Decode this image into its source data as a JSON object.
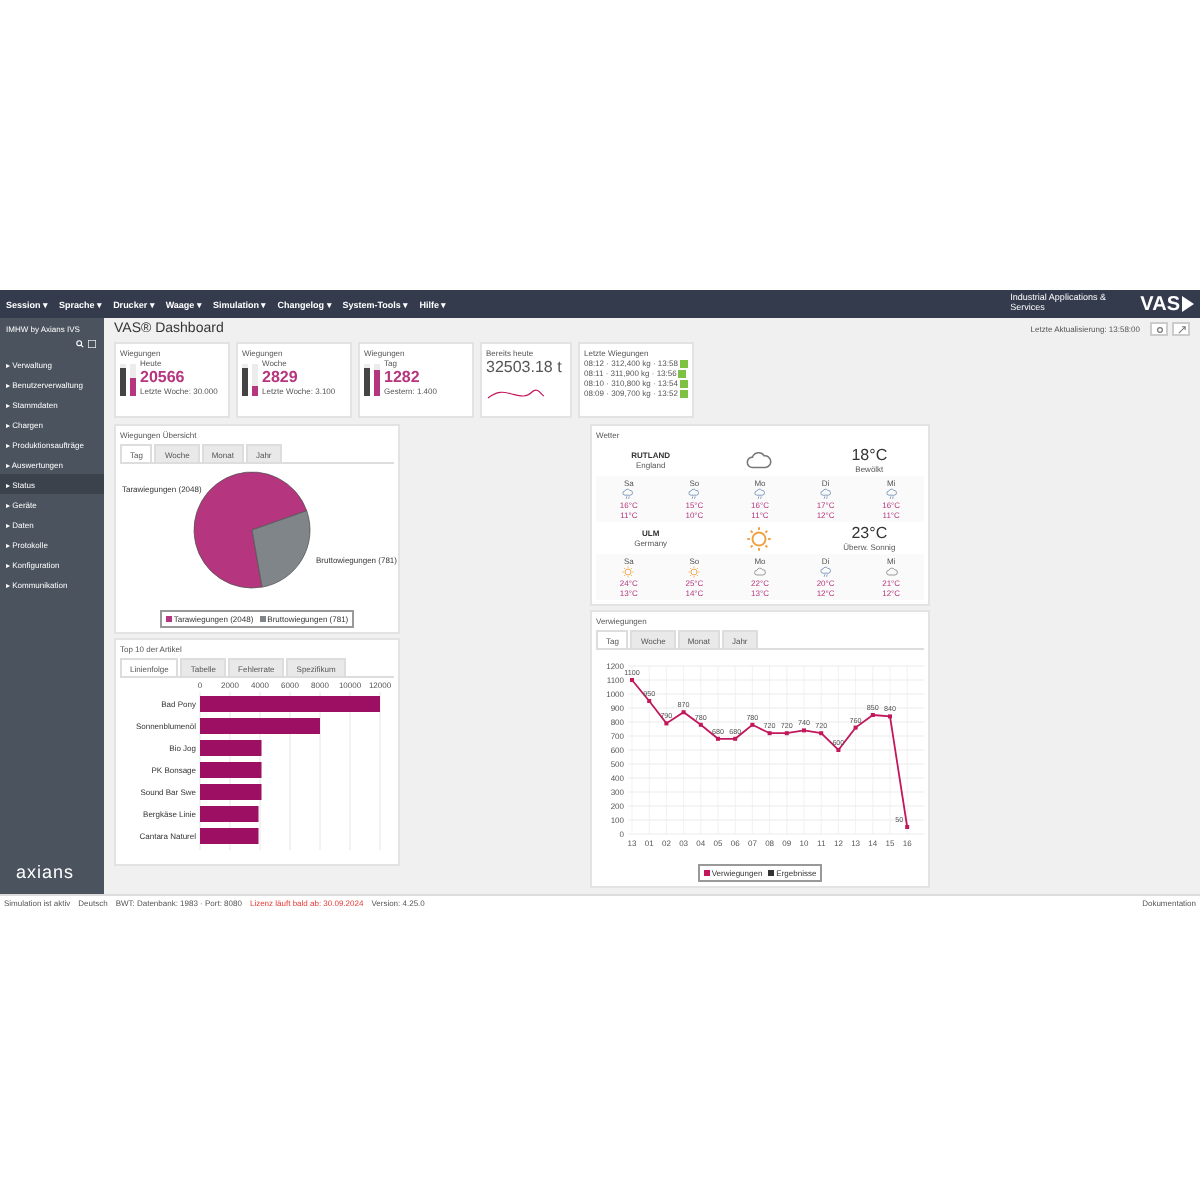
{
  "menu": [
    {
      "label": "Session",
      "caret": "▾"
    },
    {
      "label": "Sprache",
      "caret": "▾"
    },
    {
      "label": "Drucker",
      "caret": "▾"
    },
    {
      "label": "Waage",
      "caret": "▾"
    },
    {
      "label": "Simulation",
      "caret": "▾"
    },
    {
      "label": "Changelog",
      "caret": "▾"
    },
    {
      "label": "System-Tools",
      "caret": "▾"
    },
    {
      "label": "Hilfe",
      "caret": "▾"
    }
  ],
  "brand": {
    "text": "Industrial Applications & Services",
    "logo": "VAS"
  },
  "sidebar": {
    "title": "IMHW by Axians IVS",
    "footer_logo": "axians",
    "items": [
      {
        "label": "Verwaltung",
        "arrow": "▸",
        "selected": false
      },
      {
        "label": "Benutzerverwaltung",
        "arrow": "▸",
        "selected": false
      },
      {
        "label": "Stammdaten",
        "arrow": "▸",
        "selected": false
      },
      {
        "label": "Chargen",
        "arrow": "▸",
        "selected": false
      },
      {
        "label": "Produktionsaufträge",
        "arrow": "▸",
        "selected": false
      },
      {
        "label": "Auswertungen",
        "arrow": "▸",
        "selected": false
      },
      {
        "label": "Status",
        "arrow": "▸",
        "selected": true
      },
      {
        "label": "Geräte",
        "arrow": "▸",
        "selected": false
      },
      {
        "label": "Daten",
        "arrow": "▸",
        "selected": false
      },
      {
        "label": "Protokolle",
        "arrow": "▸",
        "selected": false
      },
      {
        "label": "Konfiguration",
        "arrow": "▸",
        "selected": false
      },
      {
        "label": "Kommunikation",
        "arrow": "▸",
        "selected": false
      }
    ]
  },
  "page": {
    "title": "VAS® Dashboard",
    "last_update": "Letzte Aktualisierung: 13:58:00"
  },
  "kpis": [
    {
      "title": "Wiegungen",
      "subtitle": "Heute",
      "value": "20566",
      "note": "Letzte Woche: 30.000",
      "bars": [
        {
          "level": 0.9
        },
        {
          "level": 0.55
        }
      ]
    },
    {
      "title": "Wiegungen",
      "subtitle": "Woche",
      "value": "2829",
      "note": "Letzte Woche: 3.100",
      "bars": [
        {
          "level": 0.9
        },
        {
          "level": 0.3
        }
      ]
    },
    {
      "title": "Wiegungen",
      "subtitle": "Tag",
      "value": "1282",
      "note": "Gestern: 1.400",
      "bars": [
        {
          "level": 0.9
        },
        {
          "level": 0.8
        }
      ]
    }
  ],
  "total": {
    "title": "Bereits heute",
    "value": "32503.18 t"
  },
  "last_weighings": {
    "title": "Letzte Wiegungen",
    "rows": [
      {
        "text": "08:12 · 312,400 kg · 13:58"
      },
      {
        "text": "08:11 · 311,900 kg · 13:56"
      },
      {
        "text": "08:10 · 310,800 kg · 13:54"
      },
      {
        "text": "08:09 · 309,700 kg · 13:52"
      }
    ]
  },
  "pie_card": {
    "title": "Wiegungen Übersicht",
    "tabs": [
      {
        "label": "Tag",
        "selected": true
      },
      {
        "label": "Woche",
        "selected": false
      },
      {
        "label": "Monat",
        "selected": false
      },
      {
        "label": "Jahr",
        "selected": false
      }
    ],
    "chart_data": {
      "type": "pie",
      "categories": [
        "Tarawiegungen (2048)",
        "Bruttowiegungen (781)"
      ],
      "values": [
        2048,
        781
      ],
      "colors": [
        "#b5357f",
        "#7f8588"
      ]
    }
  },
  "bar_card": {
    "title": "Top 10 der Artikel",
    "tabs": [
      {
        "label": "Linienfolge",
        "selected": true
      },
      {
        "label": "Tabelle",
        "selected": false
      },
      {
        "label": "Fehlerrate",
        "selected": false
      },
      {
        "label": "Spezifikum",
        "selected": false
      }
    ],
    "chart_data": {
      "type": "bar",
      "orientation": "horizontal",
      "grid": true,
      "categories": [
        "Bad Pony",
        "Sonnenblumenöl",
        "Bio Jog",
        "PK Bonsage",
        "Sound Bar Swe",
        "Bergkäse Linie",
        "Cantara Naturel"
      ],
      "values": [
        12000,
        8000,
        4100,
        4100,
        4100,
        3900,
        3900
      ],
      "color": "#9c0f63",
      "xlim": [
        0,
        12000
      ],
      "xticks": [
        0,
        2000,
        4000,
        6000,
        8000,
        10000,
        12000
      ]
    }
  },
  "weather": {
    "title": "Wetter",
    "locations": [
      {
        "name": "RUTLAND",
        "region": "England",
        "kind": "cloud",
        "temp": "18°C",
        "desc": "Bewölkt",
        "forecast": [
          {
            "day": "Sa",
            "kind": "rain",
            "high": "16°C",
            "low": "11°C"
          },
          {
            "day": "So",
            "kind": "rain",
            "high": "15°C",
            "low": "10°C"
          },
          {
            "day": "Mo",
            "kind": "rain",
            "high": "16°C",
            "low": "11°C"
          },
          {
            "day": "Di",
            "kind": "rain",
            "high": "17°C",
            "low": "12°C"
          },
          {
            "day": "Mi",
            "kind": "rain",
            "high": "16°C",
            "low": "11°C"
          }
        ]
      },
      {
        "name": "ULM",
        "region": "Germany",
        "kind": "sun",
        "temp": "23°C",
        "desc": "Überw. Sonnig",
        "forecast": [
          {
            "day": "Sa",
            "kind": "sun",
            "high": "24°C",
            "low": "13°C"
          },
          {
            "day": "So",
            "kind": "sun",
            "high": "25°C",
            "low": "14°C"
          },
          {
            "day": "Mo",
            "kind": "cloud",
            "high": "22°C",
            "low": "13°C"
          },
          {
            "day": "Di",
            "kind": "rain",
            "high": "20°C",
            "low": "12°C"
          },
          {
            "day": "Mi",
            "kind": "cloud",
            "high": "21°C",
            "low": "12°C"
          }
        ]
      }
    ]
  },
  "line_card": {
    "title": "Verwiegungen",
    "tabs": [
      {
        "label": "Tag",
        "selected": true
      },
      {
        "label": "Woche",
        "selected": false
      },
      {
        "label": "Monat",
        "selected": false
      },
      {
        "label": "Jahr",
        "selected": false
      }
    ],
    "chart_data": {
      "type": "line",
      "grid": true,
      "categories": [
        "13",
        "01",
        "02",
        "03",
        "04",
        "05",
        "06",
        "07",
        "08",
        "09",
        "10",
        "11",
        "12",
        "13",
        "14",
        "15",
        "16"
      ],
      "ylim": [
        0,
        1200
      ],
      "yticks": [
        0,
        100,
        200,
        300,
        400,
        500,
        600,
        700,
        800,
        900,
        1000,
        1100,
        1200
      ],
      "series": [
        {
          "name": "Verwiegungen",
          "color": "#c2185b",
          "marker": "square",
          "values": [
            1100,
            950,
            790,
            870,
            780,
            680,
            680,
            780,
            720,
            720,
            740,
            720,
            600,
            760,
            850,
            840,
            50
          ],
          "value_labels": [
            "1100",
            "950",
            "790",
            "870",
            "780",
            "680",
            "680",
            "780",
            "720",
            "720",
            "740",
            "720",
            "600",
            "760",
            "850",
            "840",
            "50"
          ]
        }
      ]
    },
    "extra_legend": [
      {
        "label": "Ergebnisse",
        "color": "#333333"
      }
    ]
  },
  "status_bar": {
    "items": [
      {
        "text": "Simulation ist aktiv",
        "kind": "normal"
      },
      {
        "text": "Deutsch",
        "kind": "normal"
      },
      {
        "text": "BWT: Datenbank: 1983 · Port: 8080",
        "kind": "normal"
      },
      {
        "text": "Lizenz läuft bald ab: 30.09.2024",
        "kind": "warning"
      },
      {
        "text": "Version: 4.25.0",
        "kind": "normal"
      }
    ],
    "right": "Dokumentation"
  }
}
